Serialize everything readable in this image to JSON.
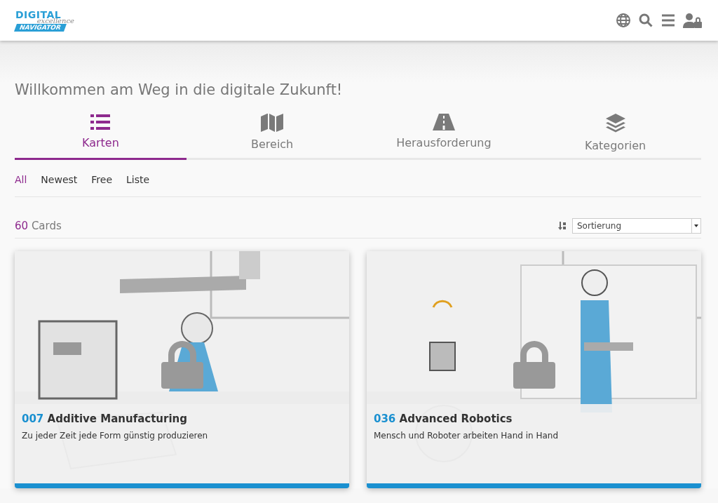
{
  "logo": {
    "line_1": "DIGITAL",
    "line_2": "excellence",
    "line_3": "NAVIGATOR"
  },
  "header_icons": [
    {
      "kind": "globe"
    },
    {
      "kind": "search"
    },
    {
      "kind": "menu"
    },
    {
      "kind": "user-lock"
    }
  ],
  "heading": "Willkommen am Weg in die digitale Zukunft!",
  "tabs": [
    {
      "label": "Karten",
      "selected": true
    },
    {
      "label": "Bereich",
      "selected": false
    },
    {
      "label": "Herausforderung",
      "selected": false
    },
    {
      "label": "Kategorien",
      "selected": false
    }
  ],
  "filters": [
    {
      "label": "All",
      "selected": true
    },
    {
      "label": "Newest",
      "selected": false
    },
    {
      "label": "Free",
      "selected": false
    },
    {
      "label": "Liste",
      "selected": false
    }
  ],
  "count": {
    "number": "60",
    "label": "Cards"
  },
  "sort": {
    "value": "Sortierung"
  },
  "cards": [
    {
      "number": "007",
      "title": "Additive Manufacturing",
      "subtitle": "Zu jeder Zeit jede Form günstig produzieren",
      "locked": true
    },
    {
      "number": "036",
      "title": "Advanced Robotics",
      "subtitle": "Mensch und Roboter arbeiten Hand in Hand",
      "locked": true
    }
  ]
}
